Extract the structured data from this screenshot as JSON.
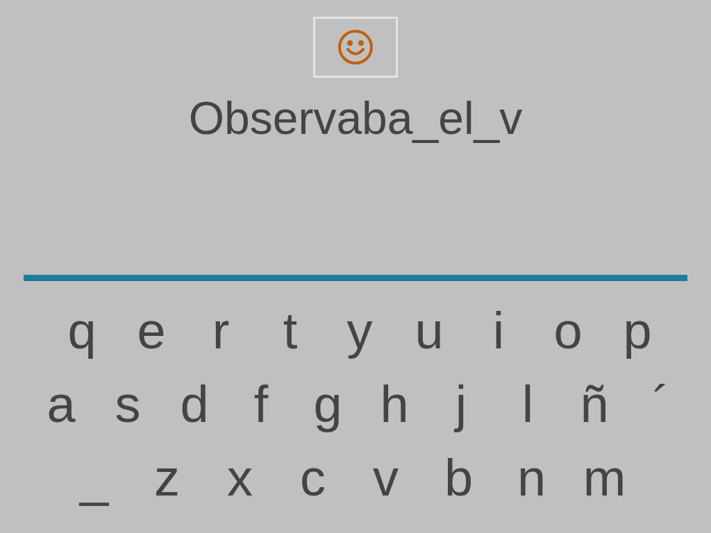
{
  "answer": "Observaba_el_v",
  "keyboard": [
    [
      "q",
      "e",
      "r",
      "t",
      "y",
      "u",
      "i",
      "o",
      "p"
    ],
    [
      "a",
      "s",
      "d",
      "f",
      "g",
      "h",
      "j",
      "l",
      "ñ",
      "´"
    ],
    [
      "_",
      "z",
      "x",
      "c",
      "v",
      "b",
      "n",
      "m"
    ]
  ]
}
